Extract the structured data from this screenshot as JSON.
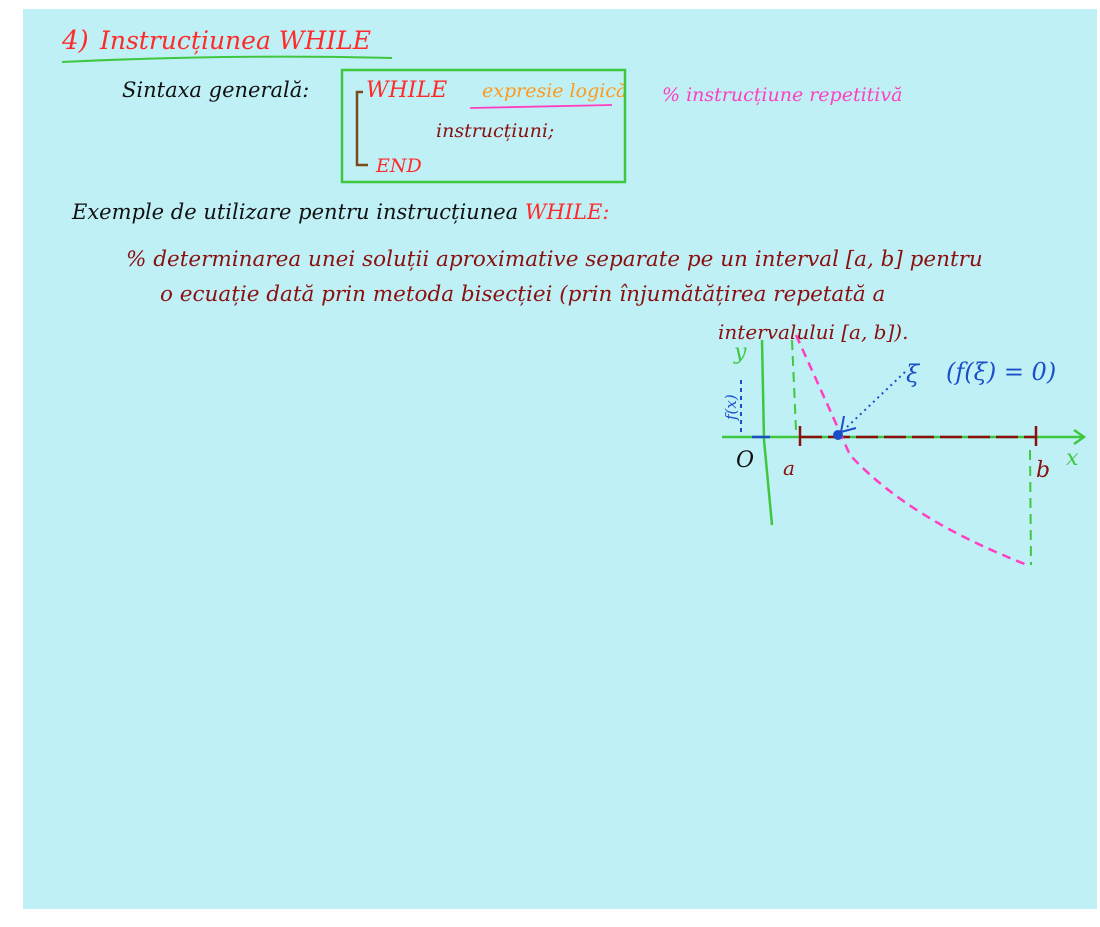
{
  "heading": {
    "number": "4)",
    "title": "Instrucțiunea WHILE"
  },
  "syntax": {
    "label": "Sintaxa generală:",
    "keyword_while": "WHILE",
    "condition": "expresie logică",
    "body": "instrucțiuni;",
    "keyword_end": "END",
    "comment": "% instrucțiune repetitivă"
  },
  "example": {
    "intro_prefix": "Exemple de utilizare pentru instrucțiunea",
    "intro_keyword": "WHILE:",
    "line1": "% determinarea unei soluții aproximative separate pe un interval [a, b] pentru",
    "line2": "o ecuație dată prin metoda bisecției (prin înjumătățirea repetată a",
    "line3": "intervalului [a, b])."
  },
  "diagram": {
    "y_axis_label": "y",
    "fx_label": "f(x)",
    "origin_label": "O",
    "x_axis_label": "x",
    "a_label": "a",
    "b_label": "b",
    "root_label": "ξ",
    "root_condition": "(f(ξ) = 0)",
    "colors": {
      "axes": "#3fc83f",
      "curve": "#ff3fc0",
      "segment": "#8a1010",
      "root": "#1a4fc8"
    }
  }
}
